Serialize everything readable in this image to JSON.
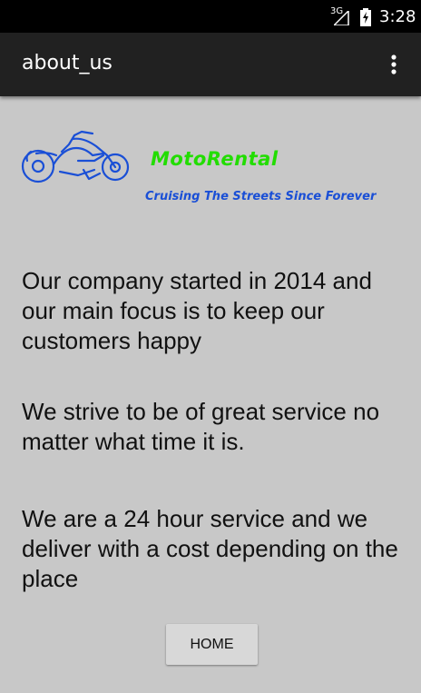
{
  "status_bar": {
    "network": "3G",
    "time": "3:28"
  },
  "action_bar": {
    "title": "about_us",
    "overflow_icon": "more-vert-icon"
  },
  "logo": {
    "brand": "MotoRental",
    "tagline": "Cruising The Streets Since Forever",
    "brand_color": "#22dd00",
    "tagline_color": "#1a4fd6",
    "icon": "motorcycle-icon"
  },
  "content": {
    "paragraph_1": "Our company started in 2014 and our main focus is to keep our customers happy",
    "paragraph_2": "We strive to be of great service no matter what time it is.",
    "paragraph_3": "We are a 24 hour service and we deliver with a cost depending on the place"
  },
  "buttons": {
    "home": "HOME"
  }
}
